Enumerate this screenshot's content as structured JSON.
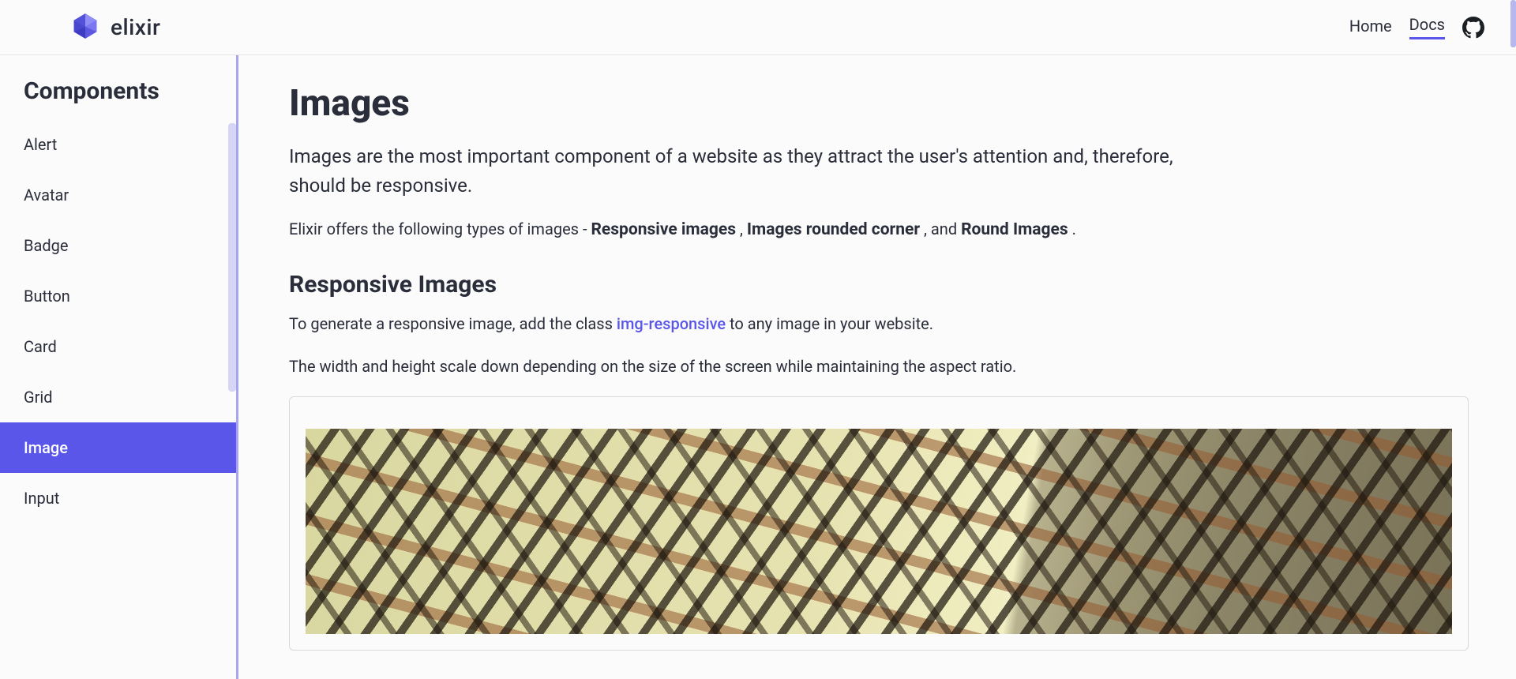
{
  "brand": {
    "name": "elixir"
  },
  "nav": {
    "items": [
      {
        "label": "Home",
        "active": false
      },
      {
        "label": "Docs",
        "active": true
      }
    ],
    "github_icon": "github-icon"
  },
  "sidebar": {
    "title": "Components",
    "items": [
      {
        "label": "Alert",
        "active": false
      },
      {
        "label": "Avatar",
        "active": false
      },
      {
        "label": "Badge",
        "active": false
      },
      {
        "label": "Button",
        "active": false
      },
      {
        "label": "Card",
        "active": false
      },
      {
        "label": "Grid",
        "active": false
      },
      {
        "label": "Image",
        "active": true
      },
      {
        "label": "Input",
        "active": false
      }
    ]
  },
  "main": {
    "title": "Images",
    "intro": "Images are the most important component of a website as they attract the user's attention and, therefore, should be responsive.",
    "offers_prefix": "Elixir offers the following types of images - ",
    "types": {
      "t1": "Responsive images",
      "sep1": " , ",
      "t2": "Images rounded corner",
      "sep_and": " , and ",
      "t3": "Round Images",
      "suffix": " ."
    },
    "section1_title": "Responsive Images",
    "section1_p1_a": "To generate a responsive image, add the class ",
    "section1_p1_code": "img-responsive",
    "section1_p1_b": " to any image in your website.",
    "section1_p2": "The width and height scale down depending on the size of the screen while maintaining the aspect ratio."
  },
  "colors": {
    "accent": "#5956e9",
    "accent_light": "#a6a5f2",
    "text": "#2a2d3a",
    "bg": "#fbfbfc"
  }
}
